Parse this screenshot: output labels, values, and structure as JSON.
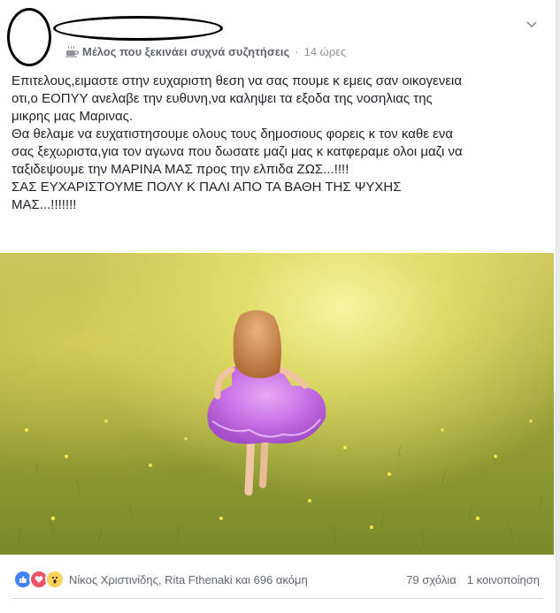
{
  "post": {
    "author_badge_icon": "coffee-cup-icon",
    "author_role": "Μέλος που ξεκινάει συχνά συζητήσεις",
    "separator": "·",
    "timestamp": "14 ώρες",
    "text_lines": [
      "Επιτελους,ειμαστε στην ευχαριστη θεση να σας πουμε κ εμεις σαν οικογενεια",
      "οτι,ο ΕΟΠΥΥ ανελαβε την ευθυνη,να καληψει τα εξοδα της νοσηλιας της",
      "μικρης μας Μαρινας.",
      "Θα θελαμε να ευχατιστησουμε ολους τους δημοσιους φορεις κ τον καθε ενα",
      "σας ξεχωριστα,για τον αγωνα που δωσατε μαζι μας κ κατφεραμε ολοι μαζι να",
      "ταξιδεψουμε την ΜΑΡΙΝΑ ΜΑΣ προς την ελπιδα ΖΩΣ...!!!!",
      "ΣΑΣ ΕΥΧΑΡΙΣΤΟΥΜΕ ΠΟΛΥ Κ ΠΑΛΙ ΑΠΟ ΤΑ ΒΑΘΗ ΤΗΣ ΨΥΧΗΣ",
      "ΜΑΣ...!!!!!!!"
    ]
  },
  "reactions": {
    "types": [
      "like",
      "love",
      "wow"
    ],
    "names": "Νίκος Χριστινίδης, Rita Fthenaki και 696 ακόμη",
    "comments": "79 σχόλια",
    "shares": "1 κοινοποίηση"
  },
  "colors": {
    "like": "#4080ff",
    "love": "#f25268",
    "wow": "#fdd25a",
    "meta_text": "#90949c"
  }
}
